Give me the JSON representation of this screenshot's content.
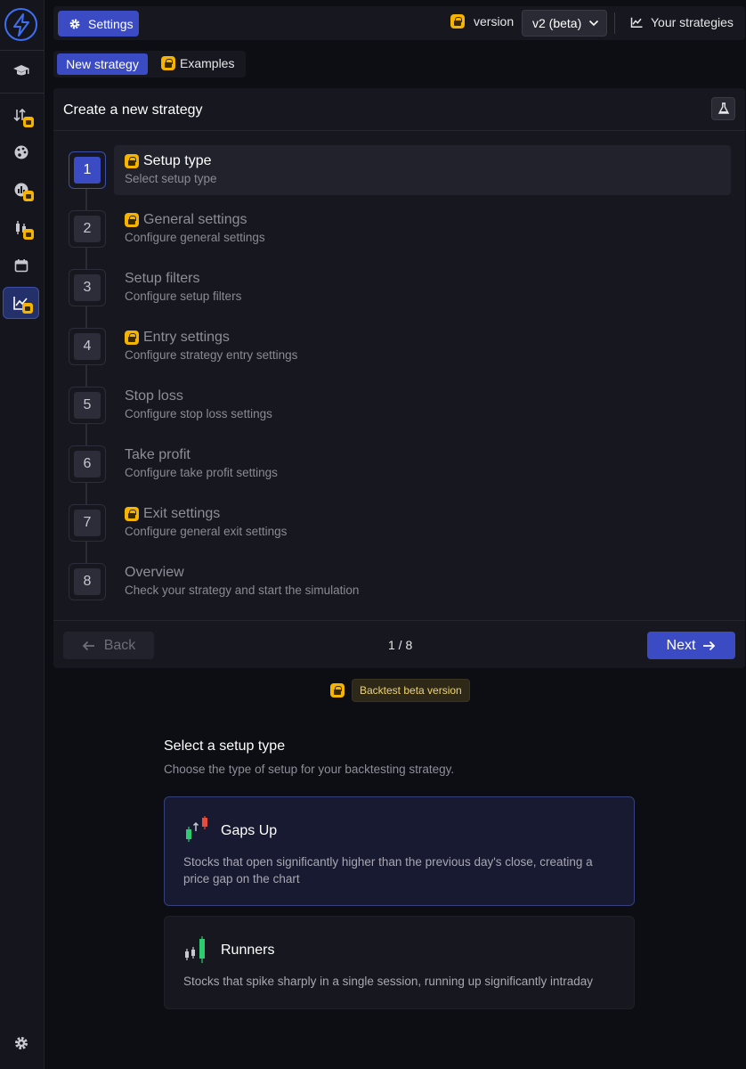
{
  "topbar": {
    "settings_label": "Settings",
    "version_label": "version",
    "version_value": "v2 (beta)",
    "your_strategies_label": "Your strategies"
  },
  "tabs": {
    "new_strategy": "New strategy",
    "examples": "Examples"
  },
  "panel": {
    "title": "Create a new strategy",
    "steps": [
      {
        "num": "1",
        "title": "Setup type",
        "subtitle": "Select setup type",
        "locked": true,
        "active": true
      },
      {
        "num": "2",
        "title": "General settings",
        "subtitle": "Configure general settings",
        "locked": true,
        "active": false
      },
      {
        "num": "3",
        "title": "Setup filters",
        "subtitle": "Configure setup filters",
        "locked": false,
        "active": false
      },
      {
        "num": "4",
        "title": "Entry settings",
        "subtitle": "Configure strategy entry settings",
        "locked": true,
        "active": false
      },
      {
        "num": "5",
        "title": "Stop loss",
        "subtitle": "Configure stop loss settings",
        "locked": false,
        "active": false
      },
      {
        "num": "6",
        "title": "Take profit",
        "subtitle": "Configure take profit settings",
        "locked": false,
        "active": false
      },
      {
        "num": "7",
        "title": "Exit settings",
        "subtitle": "Configure general exit settings",
        "locked": true,
        "active": false
      },
      {
        "num": "8",
        "title": "Overview",
        "subtitle": "Check your strategy and start the simulation",
        "locked": false,
        "active": false
      }
    ],
    "back_label": "Back",
    "page_indicator": "1 / 8",
    "next_label": "Next"
  },
  "beta_badge": "Backtest beta version",
  "setup": {
    "title": "Select a setup type",
    "subtitle": "Choose the type of setup for your backtesting strategy.",
    "cards": [
      {
        "title": "Gaps Up",
        "description": "Stocks that open significantly higher than the previous day's close, creating a price gap on the chart",
        "selected": true
      },
      {
        "title": "Runners",
        "description": "Stocks that spike sharply in a single session, running up significantly intraday",
        "selected": false
      }
    ]
  },
  "colors": {
    "accent": "#3b4bc4",
    "lock": "#f4b400",
    "background": "#0d0d14",
    "panel": "#17171f"
  },
  "icons": {
    "sidebar": [
      "logo-icon",
      "graduation-cap-icon",
      "sort-arrows-icon",
      "palette-icon",
      "bar-chart-icon",
      "candles-icon",
      "calendar-icon",
      "line-chart-icon",
      "gear-icon"
    ]
  }
}
